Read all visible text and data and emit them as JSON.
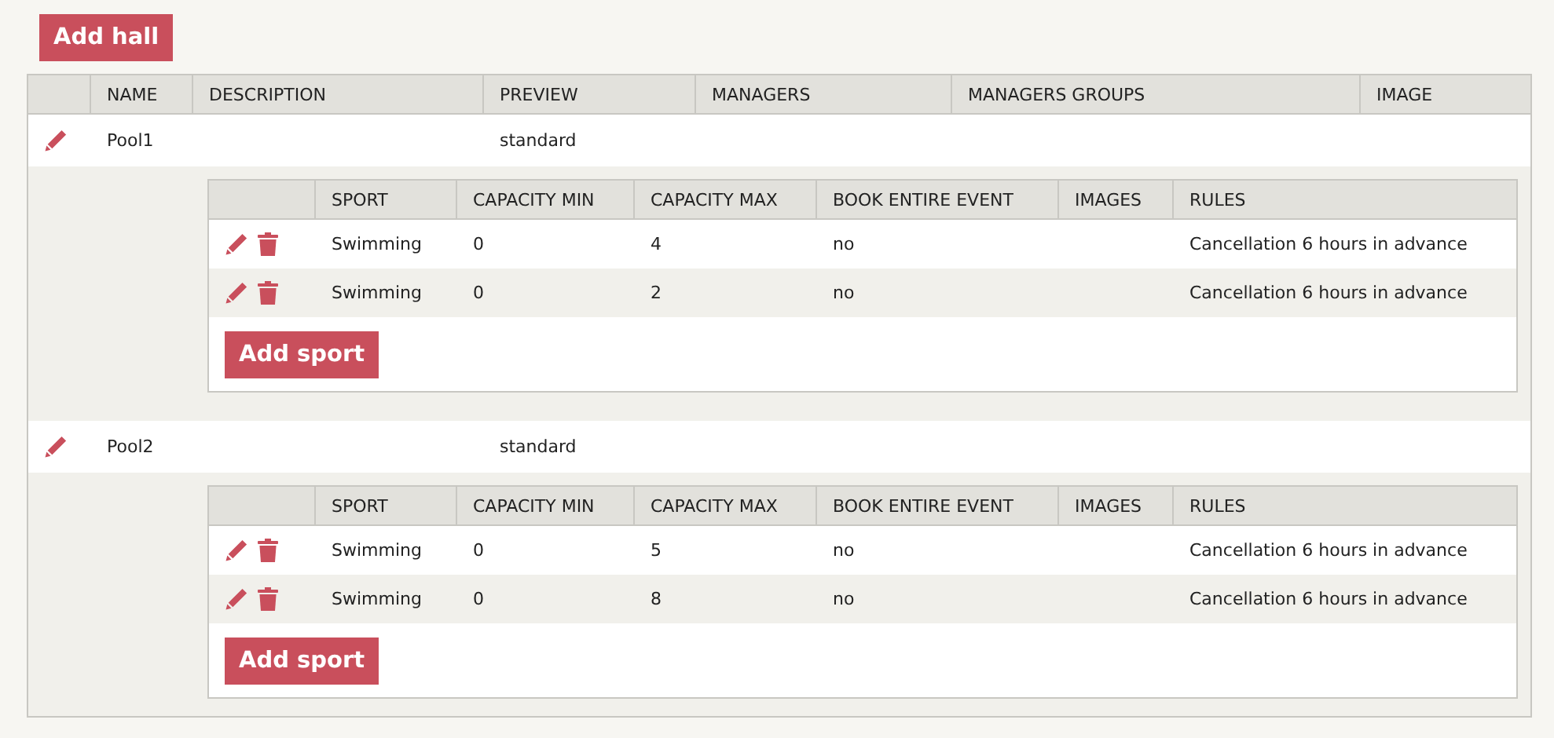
{
  "add_hall_button": "Add hall",
  "columns": [
    "NAME",
    "DESCRIPTION",
    "PREVIEW",
    "MANAGERS",
    "MANAGERS GROUPS",
    "IMAGE"
  ],
  "halls": [
    {
      "name": "Pool1",
      "preview": "standard",
      "sport_columns": [
        "SPORT",
        "CAPACITY MIN",
        "CAPACITY MAX",
        "BOOK ENTIRE EVENT",
        "IMAGES",
        "RULES"
      ],
      "sports": [
        {
          "sport": "Swimming",
          "capacity_min": "0",
          "capacity_max": "4",
          "book_entire_event": "no",
          "rules": "Cancellation 6 hours in advance"
        },
        {
          "sport": "Swimming",
          "capacity_min": "0",
          "capacity_max": "2",
          "book_entire_event": "no",
          "rules": "Cancellation 6 hours in advance"
        }
      ],
      "add_sport_button": "Add sport"
    },
    {
      "name": "Pool2",
      "preview": "standard",
      "sport_columns": [
        "SPORT",
        "CAPACITY MIN",
        "CAPACITY MAX",
        "BOOK ENTIRE EVENT",
        "IMAGES",
        "RULES"
      ],
      "sports": [
        {
          "sport": "Swimming",
          "capacity_min": "0",
          "capacity_max": "5",
          "book_entire_event": "no",
          "rules": "Cancellation 6 hours in advance"
        },
        {
          "sport": "Swimming",
          "capacity_min": "0",
          "capacity_max": "8",
          "book_entire_event": "no",
          "rules": "Cancellation 6 hours in advance"
        }
      ],
      "add_sport_button": "Add sport"
    }
  ]
}
